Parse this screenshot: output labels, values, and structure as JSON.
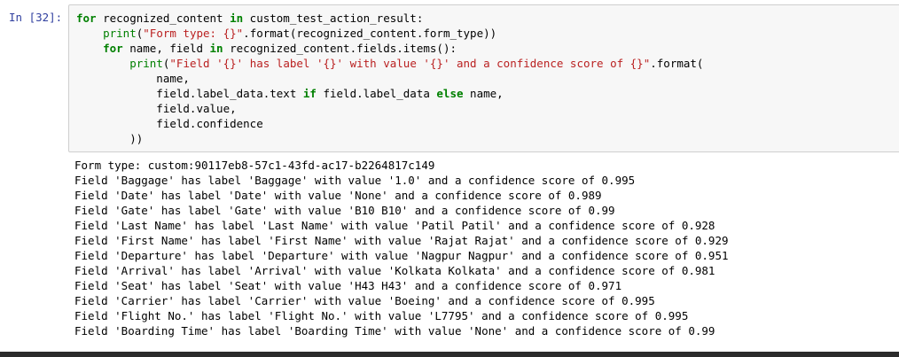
{
  "prompt_label": "In [32]:",
  "code_lines": [
    [
      {
        "t": "kw",
        "v": "for"
      },
      {
        "t": "p",
        "v": " recognized_content "
      },
      {
        "t": "kw",
        "v": "in"
      },
      {
        "t": "p",
        "v": " custom_test_action_result:"
      }
    ],
    [
      {
        "t": "p",
        "v": "    "
      },
      {
        "t": "bi",
        "v": "print"
      },
      {
        "t": "p",
        "v": "("
      },
      {
        "t": "str",
        "v": "\"Form type: {}\""
      },
      {
        "t": "p",
        "v": ".format(recognized_content.form_type))"
      }
    ],
    [
      {
        "t": "p",
        "v": "    "
      },
      {
        "t": "kw",
        "v": "for"
      },
      {
        "t": "p",
        "v": " name, field "
      },
      {
        "t": "kw",
        "v": "in"
      },
      {
        "t": "p",
        "v": " recognized_content.fields.items():"
      }
    ],
    [
      {
        "t": "p",
        "v": "        "
      },
      {
        "t": "bi",
        "v": "print"
      },
      {
        "t": "p",
        "v": "("
      },
      {
        "t": "str",
        "v": "\"Field '{}' has label '{}' with value '{}' and a confidence score of {}\""
      },
      {
        "t": "p",
        "v": ".format("
      }
    ],
    [
      {
        "t": "p",
        "v": "            name,"
      }
    ],
    [
      {
        "t": "p",
        "v": "            field.label_data.text "
      },
      {
        "t": "kw",
        "v": "if"
      },
      {
        "t": "p",
        "v": " field.label_data "
      },
      {
        "t": "kw",
        "v": "else"
      },
      {
        "t": "p",
        "v": " name,"
      }
    ],
    [
      {
        "t": "p",
        "v": "            field.value,"
      }
    ],
    [
      {
        "t": "p",
        "v": "            field.confidence"
      }
    ],
    [
      {
        "t": "p",
        "v": "        ))"
      }
    ]
  ],
  "output_lines": [
    "Form type: custom:90117eb8-57c1-43fd-ac17-b2264817c149",
    "Field 'Baggage' has label 'Baggage' with value '1.0' and a confidence score of 0.995",
    "Field 'Date' has label 'Date' with value 'None' and a confidence score of 0.989",
    "Field 'Gate' has label 'Gate' with value 'B10 B10' and a confidence score of 0.99",
    "Field 'Last Name' has label 'Last Name' with value 'Patil Patil' and a confidence score of 0.928",
    "Field 'First Name' has label 'First Name' with value 'Rajat Rajat' and a confidence score of 0.929",
    "Field 'Departure' has label 'Departure' with value 'Nagpur Nagpur' and a confidence score of 0.951",
    "Field 'Arrival' has label 'Arrival' with value 'Kolkata Kolkata' and a confidence score of 0.981",
    "Field 'Seat' has label 'Seat' with value 'H43 H43' and a confidence score of 0.971",
    "Field 'Carrier' has label 'Carrier' with value 'Boeing' and a confidence score of 0.995",
    "Field 'Flight No.' has label 'Flight No.' with value 'L7795' and a confidence score of 0.995",
    "Field 'Boarding Time' has label 'Boarding Time' with value 'None' and a confidence score of 0.99"
  ],
  "colors": {
    "prompt": "#303f9f",
    "keyword": "#008000",
    "string": "#ba2121",
    "input_bg": "#f7f7f7",
    "input_border": "#cfcfcf"
  }
}
